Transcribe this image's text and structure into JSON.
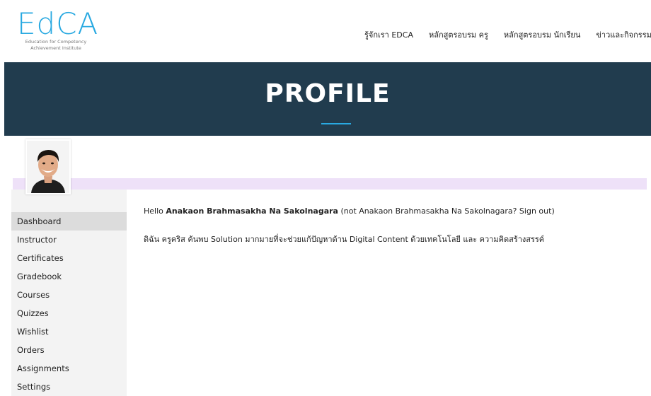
{
  "header": {
    "logo_text": "EdCA",
    "logo_subtitle_line1": "Education for Competency",
    "logo_subtitle_line2": "Achievement Institute",
    "nav": [
      {
        "label": "รู้จักเรา EDCA"
      },
      {
        "label": "หลักสูตรอบรม ครู"
      },
      {
        "label": "หลักสูตรอบรม นักเรียน"
      },
      {
        "label": "ข่าวและกิจกรรม"
      }
    ]
  },
  "banner": {
    "title": "PROFILE"
  },
  "sidebar": {
    "items": [
      {
        "label": "Dashboard",
        "active": true
      },
      {
        "label": "Instructor"
      },
      {
        "label": "Certificates"
      },
      {
        "label": "Gradebook"
      },
      {
        "label": "Courses"
      },
      {
        "label": "Quizzes"
      },
      {
        "label": "Wishlist"
      },
      {
        "label": "Orders"
      },
      {
        "label": "Assignments"
      },
      {
        "label": "Settings"
      }
    ]
  },
  "main": {
    "hello_prefix": "Hello ",
    "user_name": "Anakaon Brahmasakha Na Sakolnagara",
    "hello_not": " (not Anakaon Brahmasakha Na Sakolnagara? ",
    "sign_out": "Sign out",
    "hello_suffix": ")",
    "description": "ดิฉัน ครูคริส ค้นพบ Solution มากมายที่จะช่วยแก้ปัญหาด้าน Digital Content ด้วยเทคโนโลยี และ ความคิดสร้างสรรค์"
  },
  "colors": {
    "brand": "#29a9e1",
    "banner": "#213c4e",
    "strip": "#eee1f8",
    "sidebar_bg": "#f3f3f3",
    "sidebar_active": "#dcdcdc"
  }
}
